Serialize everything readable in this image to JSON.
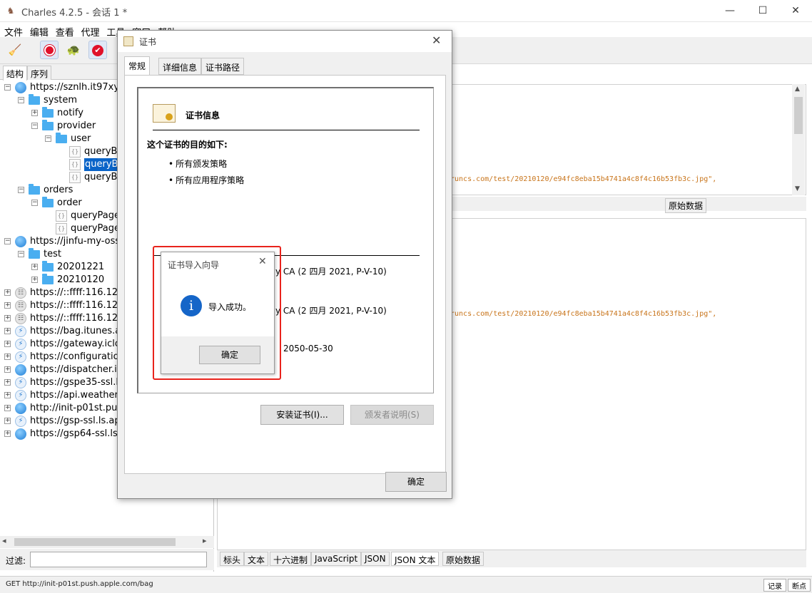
{
  "window": {
    "title": "Charles 4.2.5 - 会话 1 *",
    "controls": {
      "minimize": "—",
      "maximize": "☐",
      "close": "✕"
    }
  },
  "menu": [
    "文件",
    "编辑",
    "查看",
    "代理",
    "工具",
    "窗口",
    "帮助"
  ],
  "toolbar": {
    "items": [
      "broom-icon",
      "record-icon",
      "throttle-turtle-icon",
      "breakpoint-check-icon"
    ]
  },
  "left_panel": {
    "tabs": [
      "结构",
      "序列"
    ],
    "tree": [
      {
        "label": "https://sznlh.it97xy.cn",
        "depth": 0,
        "icon": "globe-icon",
        "expander": "minus"
      },
      {
        "label": "system",
        "depth": 1,
        "icon": "folder-icon",
        "expander": "minus"
      },
      {
        "label": "notify",
        "depth": 2,
        "icon": "folder-icon",
        "expander": "plus"
      },
      {
        "label": "provider",
        "depth": 2,
        "icon": "folder-icon",
        "expander": "minus"
      },
      {
        "label": "user",
        "depth": 3,
        "icon": "folder-icon",
        "expander": "minus"
      },
      {
        "label": "queryBy",
        "depth": 4,
        "icon": "json-file-icon",
        "expander": ""
      },
      {
        "label": "queryBy",
        "depth": 4,
        "icon": "json-file-icon",
        "expander": "",
        "selected": true
      },
      {
        "label": "queryBy",
        "depth": 4,
        "icon": "json-file-icon",
        "expander": ""
      },
      {
        "label": "orders",
        "depth": 1,
        "icon": "folder-icon",
        "expander": "minus"
      },
      {
        "label": "order",
        "depth": 2,
        "icon": "folder-icon",
        "expander": "minus"
      },
      {
        "label": "queryPage",
        "depth": 3,
        "icon": "json-file-icon",
        "expander": ""
      },
      {
        "label": "queryPage",
        "depth": 3,
        "icon": "json-file-icon",
        "expander": ""
      },
      {
        "label": "https://jinfu-my-oss.o",
        "depth": 0,
        "icon": "globe-icon",
        "expander": "minus"
      },
      {
        "label": "test",
        "depth": 1,
        "icon": "folder-icon",
        "expander": "minus"
      },
      {
        "label": "20201221",
        "depth": 2,
        "icon": "folder-icon",
        "expander": "plus"
      },
      {
        "label": "20210120",
        "depth": 2,
        "icon": "folder-icon",
        "expander": "plus"
      },
      {
        "label": "https://::ffff:116.128.1",
        "depth": 0,
        "icon": "lock-icon",
        "expander": "plus"
      },
      {
        "label": "https://::ffff:116.128.1",
        "depth": 0,
        "icon": "lock-icon",
        "expander": "plus"
      },
      {
        "label": "https://::ffff:116.128.1",
        "depth": 0,
        "icon": "lock-icon",
        "expander": "plus"
      },
      {
        "label": "https://bag.itunes.app",
        "depth": 0,
        "icon": "bolt-icon",
        "expander": "plus"
      },
      {
        "label": "https://gateway.icloud",
        "depth": 0,
        "icon": "bolt-icon",
        "expander": "plus"
      },
      {
        "label": "https://configuration.",
        "depth": 0,
        "icon": "bolt-icon",
        "expander": "plus"
      },
      {
        "label": "https://dispatcher.is.a",
        "depth": 0,
        "icon": "globe-icon",
        "expander": "plus"
      },
      {
        "label": "https://gspe35-ssl.ls.a",
        "depth": 0,
        "icon": "bolt-icon",
        "expander": "plus"
      },
      {
        "label": "https://api.weather.co",
        "depth": 0,
        "icon": "bolt-icon",
        "expander": "plus"
      },
      {
        "label": "http://init-p01st.push.",
        "depth": 0,
        "icon": "globe-icon",
        "expander": "plus"
      },
      {
        "label": "https://gsp-ssl.ls.app",
        "depth": 0,
        "icon": "bolt-icon",
        "expander": "plus"
      },
      {
        "label": "https://gsp64-ssl.ls.ap",
        "depth": 0,
        "icon": "globe-icon",
        "expander": "plus"
      }
    ],
    "filter_label": "过滤:",
    "filter_value": ""
  },
  "right_panel": {
    "url_line_top": "runcs.com/test/20210120/e94fc8eba15b4741a4c8f4c16b53fb3c.jpg\",",
    "url_line_bottom": "runcs.com/test/20210120/e94fc8eba15b4741a4c8f4c16b53fb3c.jpg\",",
    "top_tab_partial": "原始数据",
    "bottom_tabs": [
      "标头",
      "文本",
      "十六进制",
      "JavaScript",
      "JSON",
      "JSON 文本",
      "原始数据"
    ],
    "bottom_active_tab": "JSON 文本"
  },
  "status": {
    "text": "GET http://init-p01st.push.apple.com/bag",
    "record_btn": "记录",
    "breakpoint_btn": "断点"
  },
  "cert_dialog": {
    "title": "证书",
    "tabs": [
      "常规",
      "详细信息",
      "证书路径"
    ],
    "info_title": "证书信息",
    "purpose_heading": "这个证书的目的如下:",
    "purposes": [
      "所有颁发策略",
      "所有应用程序策略"
    ],
    "issued_to_tail": "y CA (2 四月 2021, P-V-10)",
    "issued_by_tail": "y CA (2 四月 2021, P-V-10)",
    "valid_to_tail": "2050-05-30",
    "install_button": "安装证书(I)...",
    "issuer_statement_button": "颁发者说明(S)",
    "ok_button": "确定"
  },
  "import_wizard": {
    "title": "证书导入向导",
    "message": "导入成功。",
    "ok_button": "确定",
    "highlight_color": "#e8231c"
  }
}
